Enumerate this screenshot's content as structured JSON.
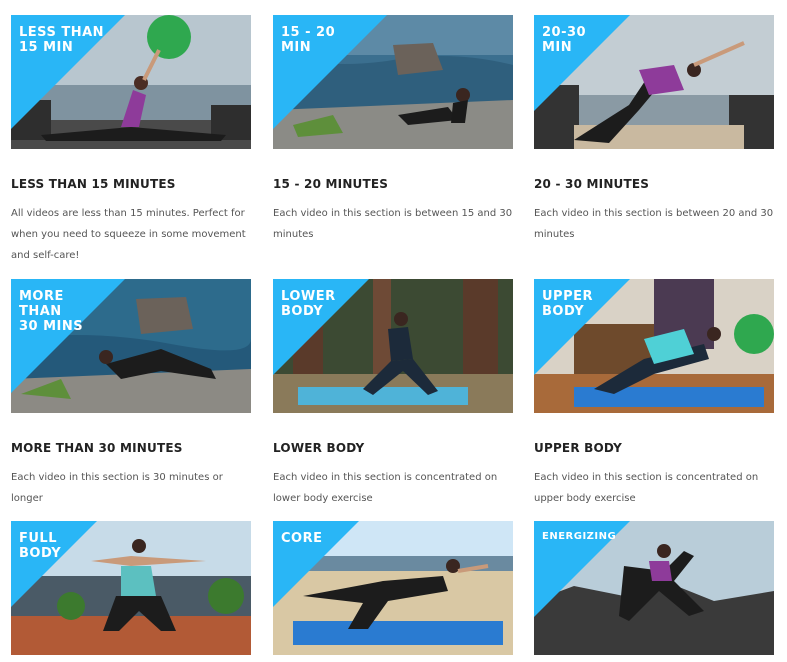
{
  "colors": {
    "badge": "#29b6f6",
    "title": "#222222",
    "description": "#555555"
  },
  "cards": [
    {
      "badge": "LESS THAN\n15 MIN",
      "title": "LESS THAN 15 MINUTES",
      "description": "All videos are less than 15 minutes. Perfect for when you need to squeeze in some movement and self-care!"
    },
    {
      "badge": "15 - 20\nMIN",
      "title": "15 - 20 MINUTES",
      "description": "Each video in this section is between 15 and 30 minutes"
    },
    {
      "badge": "20-30\nMIN",
      "title": "20 - 30 MINUTES",
      "description": "Each video in this section is between 20 and 30 minutes"
    },
    {
      "badge": "MORE THAN\n30 MINS",
      "title": "MORE THAN 30 MINUTES",
      "description": "Each video in this section is 30 minutes or longer"
    },
    {
      "badge": "LOWER\nBODY",
      "title": "LOWER BODY",
      "description": "Each video in this section is concentrated on lower body exercise"
    },
    {
      "badge": "UPPER\nBODY",
      "title": "UPPER BODY",
      "description": "Each video in this section is concentrated on upper body exercise"
    },
    {
      "badge": "FULL\nBODY",
      "title": "",
      "description": ""
    },
    {
      "badge": "CORE",
      "title": "",
      "description": ""
    },
    {
      "badge": "ENERGIZING",
      "title": "",
      "description": ""
    }
  ]
}
